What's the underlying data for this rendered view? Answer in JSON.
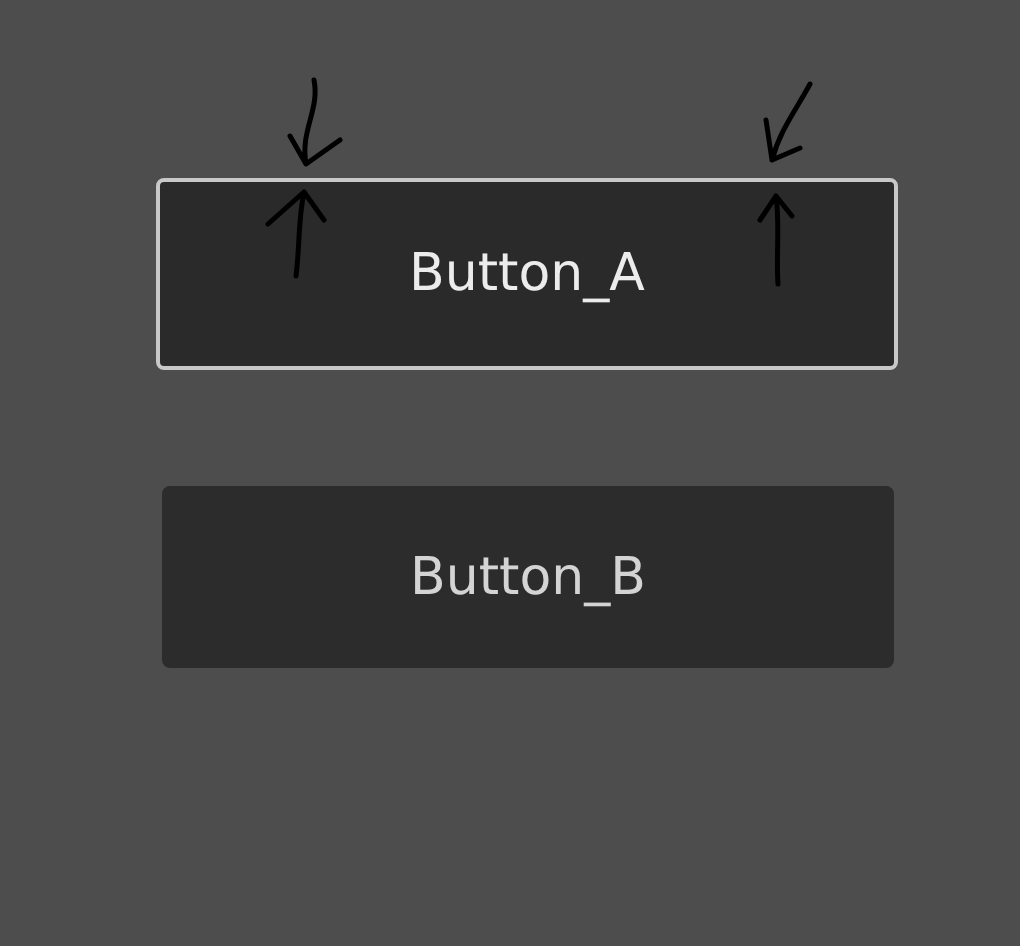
{
  "buttons": [
    {
      "label": "Button_A",
      "focused": true
    },
    {
      "label": "Button_B",
      "focused": false
    }
  ]
}
